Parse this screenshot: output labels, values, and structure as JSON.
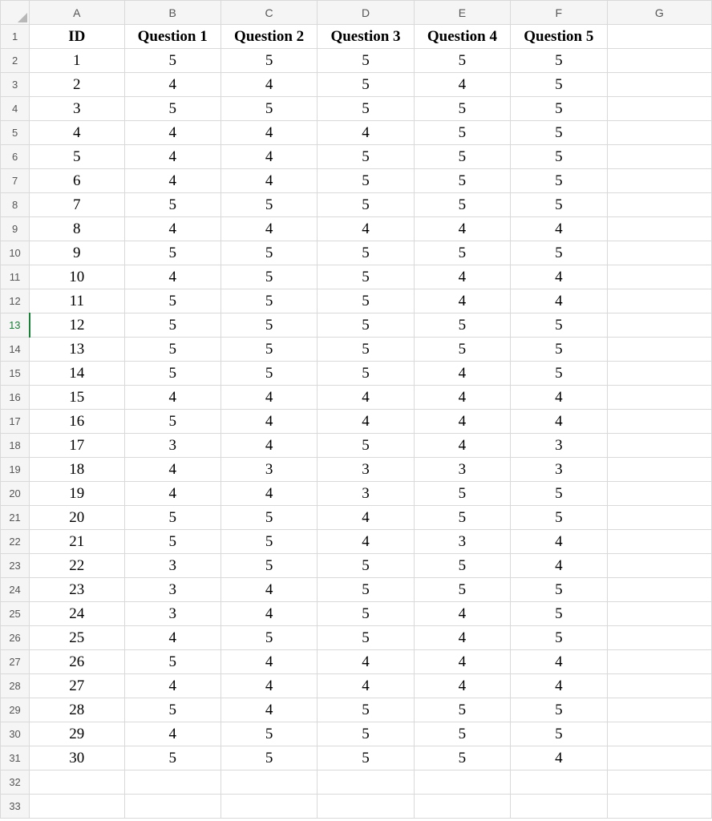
{
  "columns": [
    "A",
    "B",
    "C",
    "D",
    "E",
    "F",
    "G"
  ],
  "headers": [
    "ID",
    "Question 1",
    "Question 2",
    "Question 3",
    "Question 4",
    "Question 5",
    ""
  ],
  "selected_row_head": 13,
  "total_rows": 33,
  "rows": [
    [
      "1",
      "5",
      "5",
      "5",
      "5",
      "5",
      ""
    ],
    [
      "2",
      "4",
      "4",
      "5",
      "4",
      "5",
      ""
    ],
    [
      "3",
      "5",
      "5",
      "5",
      "5",
      "5",
      ""
    ],
    [
      "4",
      "4",
      "4",
      "4",
      "5",
      "5",
      ""
    ],
    [
      "5",
      "4",
      "4",
      "5",
      "5",
      "5",
      ""
    ],
    [
      "6",
      "4",
      "4",
      "5",
      "5",
      "5",
      ""
    ],
    [
      "7",
      "5",
      "5",
      "5",
      "5",
      "5",
      ""
    ],
    [
      "8",
      "4",
      "4",
      "4",
      "4",
      "4",
      ""
    ],
    [
      "9",
      "5",
      "5",
      "5",
      "5",
      "5",
      ""
    ],
    [
      "10",
      "4",
      "5",
      "5",
      "4",
      "4",
      ""
    ],
    [
      "11",
      "5",
      "5",
      "5",
      "4",
      "4",
      ""
    ],
    [
      "12",
      "5",
      "5",
      "5",
      "5",
      "5",
      ""
    ],
    [
      "13",
      "5",
      "5",
      "5",
      "5",
      "5",
      ""
    ],
    [
      "14",
      "5",
      "5",
      "5",
      "4",
      "5",
      ""
    ],
    [
      "15",
      "4",
      "4",
      "4",
      "4",
      "4",
      ""
    ],
    [
      "16",
      "5",
      "4",
      "4",
      "4",
      "4",
      ""
    ],
    [
      "17",
      "3",
      "4",
      "5",
      "4",
      "3",
      ""
    ],
    [
      "18",
      "4",
      "3",
      "3",
      "3",
      "3",
      ""
    ],
    [
      "19",
      "4",
      "4",
      "3",
      "5",
      "5",
      ""
    ],
    [
      "20",
      "5",
      "5",
      "4",
      "5",
      "5",
      ""
    ],
    [
      "21",
      "5",
      "5",
      "4",
      "3",
      "4",
      ""
    ],
    [
      "22",
      "3",
      "5",
      "5",
      "5",
      "4",
      ""
    ],
    [
      "23",
      "3",
      "4",
      "5",
      "5",
      "5",
      ""
    ],
    [
      "24",
      "3",
      "4",
      "5",
      "4",
      "5",
      ""
    ],
    [
      "25",
      "4",
      "5",
      "5",
      "4",
      "5",
      ""
    ],
    [
      "26",
      "5",
      "4",
      "4",
      "4",
      "4",
      ""
    ],
    [
      "27",
      "4",
      "4",
      "4",
      "4",
      "4",
      ""
    ],
    [
      "28",
      "5",
      "4",
      "5",
      "5",
      "5",
      ""
    ],
    [
      "29",
      "4",
      "5",
      "5",
      "5",
      "5",
      ""
    ],
    [
      "30",
      "5",
      "5",
      "5",
      "5",
      "4",
      ""
    ],
    [
      "",
      "",
      "",
      "",
      "",
      "",
      ""
    ],
    [
      "",
      "",
      "",
      "",
      "",
      "",
      ""
    ]
  ]
}
